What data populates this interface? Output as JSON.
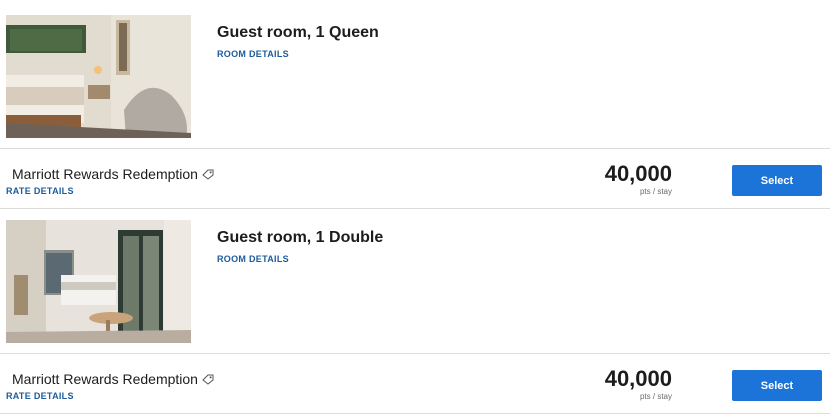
{
  "rooms": [
    {
      "name": "Guest room, 1 Queen",
      "details_link": "ROOM DETAILS",
      "image": "hotel-room-queen-photo",
      "rate": {
        "name": "Marriott Rewards Redemption",
        "icon": "tag-icon",
        "details_link": "RATE DETAILS",
        "points": "40,000",
        "points_unit": "pts / stay",
        "button": "Select"
      }
    },
    {
      "name": "Guest room, 1 Double",
      "details_link": "ROOM DETAILS",
      "image": "hotel-room-double-photo",
      "rate": {
        "name": "Marriott Rewards Redemption",
        "icon": "tag-icon",
        "details_link": "RATE DETAILS",
        "points": "40,000",
        "points_unit": "pts / stay",
        "button": "Select"
      }
    }
  ],
  "colors": {
    "accent": "#1c73d8",
    "link": "#1c5b9c",
    "divider": "#dcdcdc"
  }
}
